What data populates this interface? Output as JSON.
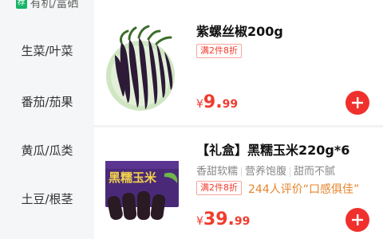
{
  "sidebar": {
    "top_tag": "荐",
    "top_label": "有机/富硒",
    "items": [
      {
        "label": "生菜/叶菜"
      },
      {
        "label": "番茄/茄果"
      },
      {
        "label": "黄瓜/瓜类"
      },
      {
        "label": "土豆/根茎"
      }
    ]
  },
  "products": [
    {
      "title": "紫螺丝椒200g",
      "promo": "满2件8折",
      "price_currency": "¥",
      "price_int": "9.",
      "price_dec": "99"
    },
    {
      "title": "【礼盒】黑糯玉米220g*6",
      "tags": [
        "香甜软糯",
        "营养饱腹",
        "甜而不腻"
      ],
      "promo": "满2件8折",
      "review": "244人评价“口感俱佳”",
      "box_label": "黑糯玉米",
      "price_currency": "¥",
      "price_int": "39.",
      "price_dec": "99"
    }
  ],
  "colors": {
    "accent": "#f0302d",
    "price": "#f03c2d",
    "review": "#e6842c",
    "tag_green": "#18b566",
    "sidebar_bg": "#f5f6f7"
  },
  "icons": [
    "plus-icon"
  ]
}
